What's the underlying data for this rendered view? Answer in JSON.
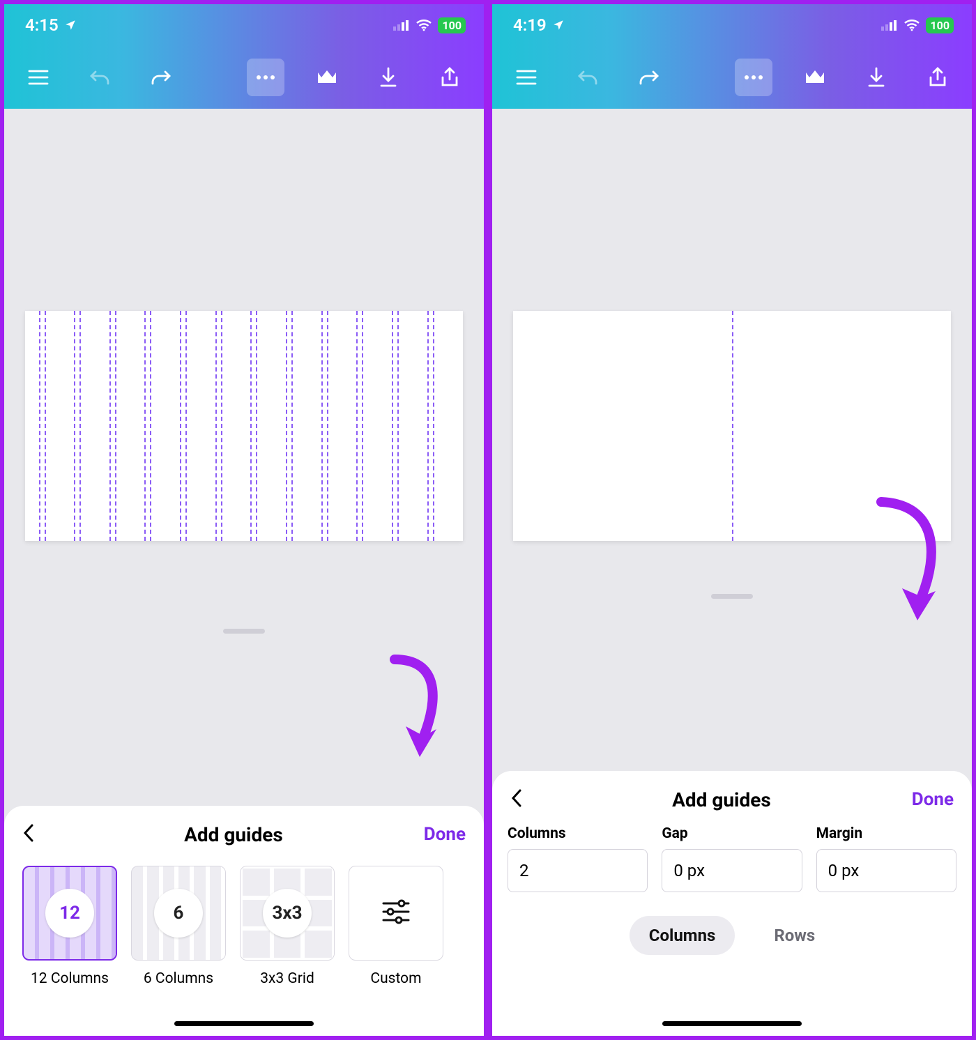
{
  "left": {
    "status": {
      "time": "4:15",
      "battery": "100"
    },
    "canvas": {
      "guide_columns": 12
    },
    "sheet": {
      "title": "Add guides",
      "done": "Done",
      "options": [
        {
          "key": "cols12",
          "circle": "12",
          "label": "12 Columns",
          "selected": true
        },
        {
          "key": "cols6",
          "circle": "6",
          "label": "6 Columns",
          "selected": false
        },
        {
          "key": "grid3",
          "circle": "3x3",
          "label": "3x3 Grid",
          "selected": false
        },
        {
          "key": "custom",
          "circle": "",
          "label": "Custom",
          "selected": false
        }
      ]
    }
  },
  "right": {
    "status": {
      "time": "4:19",
      "battery": "100"
    },
    "canvas": {
      "guide_columns": 2
    },
    "sheet": {
      "title": "Add guides",
      "done": "Done",
      "fields": {
        "columns": {
          "label": "Columns",
          "value": "2"
        },
        "gap": {
          "label": "Gap",
          "value": "0 px"
        },
        "margin": {
          "label": "Margin",
          "value": "0 px"
        }
      },
      "segment": {
        "columns": "Columns",
        "rows": "Rows",
        "active": "columns"
      }
    }
  },
  "colors": {
    "accent": "#7d2ae8",
    "guide": "#8b5cf6"
  }
}
